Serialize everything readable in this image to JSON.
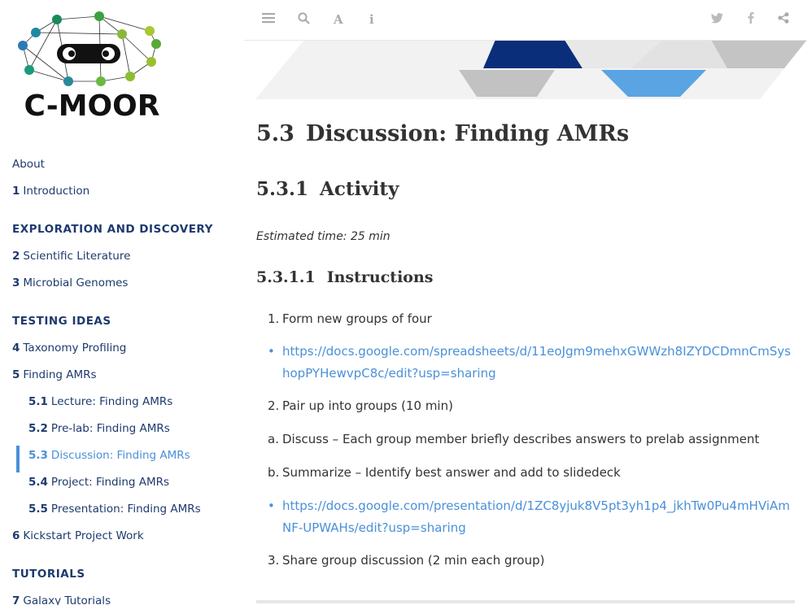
{
  "logo": {
    "text": "C-MOOR"
  },
  "sidebar": {
    "about": "About",
    "intro": {
      "num": "1",
      "label": "Introduction"
    },
    "header1": "EXPLORATION AND DISCOVERY",
    "sci": {
      "num": "2",
      "label": "Scientific Literature"
    },
    "genomes": {
      "num": "3",
      "label": "Microbial Genomes"
    },
    "header2": "TESTING IDEAS",
    "tax": {
      "num": "4",
      "label": "Taxonomy Profiling"
    },
    "amrs": {
      "num": "5",
      "label": "Finding AMRs"
    },
    "s51": {
      "num": "5.1",
      "label": "Lecture: Finding AMRs"
    },
    "s52": {
      "num": "5.2",
      "label": "Pre-lab: Finding AMRs"
    },
    "s53": {
      "num": "5.3",
      "label": "Discussion: Finding AMRs"
    },
    "s54": {
      "num": "5.4",
      "label": "Project: Finding AMRs"
    },
    "s55": {
      "num": "5.5",
      "label": "Presentation: Finding AMRs"
    },
    "kick": {
      "num": "6",
      "label": "Kickstart Project Work"
    },
    "header3": "TUTORIALS",
    "galaxy": {
      "num": "7",
      "label": "Galaxy Tutorials"
    }
  },
  "toolbar": {
    "icons": [
      "menu-icon",
      "search-icon",
      "font-icon",
      "info-icon",
      "twitter-icon",
      "facebook-icon",
      "share-icon"
    ]
  },
  "content": {
    "h1": {
      "num": "5.3",
      "text": "Discussion: Finding AMRs"
    },
    "h2": {
      "num": "5.3.1",
      "text": "Activity"
    },
    "estimated": "Estimated time: 25 min",
    "h3": {
      "num": "5.3.1.1",
      "text": "Instructions"
    },
    "items": [
      {
        "mark": "1.",
        "text": "Form new groups of four"
      },
      {
        "mark": "•",
        "text": "https://docs.google.com/spreadsheets/d/11eoJgm9mehxGWWzh8IZYDCDmnCmSyshopPYHewvpC8c/edit?usp=sharing",
        "link": true
      },
      {
        "mark": "2.",
        "text": "Pair up into groups (10 min)"
      },
      {
        "mark": "a.",
        "text": "Discuss – Each group member briefly describes answers to prelab assignment"
      },
      {
        "mark": "b.",
        "text": "Summarize – Identify best answer and add to slidedeck"
      },
      {
        "mark": "•",
        "text": "https://docs.google.com/presentation/d/1ZC8yjuk8V5pt3yh1p4_jkhTw0Pu4mHViAmNF-UPWAHs/edit?usp=sharing",
        "link": true
      },
      {
        "mark": "3.",
        "text": "Share group discussion (2 min each group)"
      }
    ]
  },
  "colors": {
    "nav": "#1e3a6e",
    "active": "#4a90d9",
    "link": "#4a90d9",
    "banner_dark": "#0a2e7a",
    "banner_light": "#5aa4e3"
  }
}
